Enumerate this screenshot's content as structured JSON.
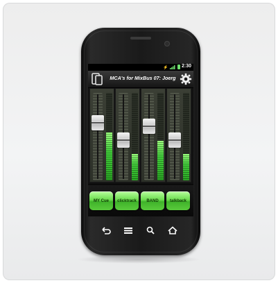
{
  "status": {
    "time": "2:30"
  },
  "titlebar": {
    "title": "MCA's for MixBus 07: Joerg"
  },
  "strips": [
    {
      "name": "MY Cue",
      "fader_level": 0.7,
      "meter_level": 0.55
    },
    {
      "name": "clicktrack",
      "fader_level": 0.45,
      "meter_level": 0.3
    },
    {
      "name": "BAND",
      "fader_level": 0.65,
      "meter_level": 0.45
    },
    {
      "name": "talkback",
      "fader_level": 0.45,
      "meter_level": 0.3
    }
  ],
  "nav": {
    "icons": [
      "back-icon",
      "menu-icon",
      "search-icon",
      "home-icon"
    ]
  },
  "colors": {
    "accent_green": "#5ecf3f",
    "meter_green": "#43d33c",
    "phone_body": "#1a1a1a"
  }
}
